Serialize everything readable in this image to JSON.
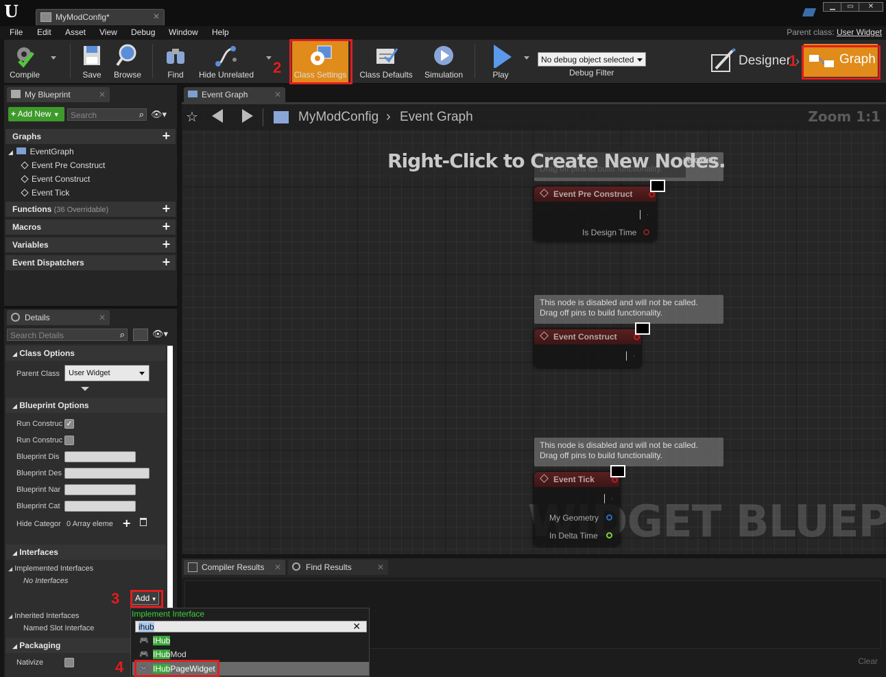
{
  "window": {
    "doc_tab": "MyModConfig*",
    "min": "▁",
    "max": "▭",
    "close": "✕"
  },
  "menu": [
    "File",
    "Edit",
    "Asset",
    "View",
    "Debug",
    "Window",
    "Help"
  ],
  "parent_class": {
    "label": "Parent class:",
    "value": "User Widget"
  },
  "toolbar": {
    "compile": "Compile",
    "save": "Save",
    "browse": "Browse",
    "find": "Find",
    "hide_unrelated": "Hide Unrelated",
    "class_settings": "Class Settings",
    "class_defaults": "Class Defaults",
    "simulation": "Simulation",
    "play": "Play",
    "debug_select": "No debug object selected",
    "debug_filter": "Debug Filter",
    "designer": "Designer",
    "graph": "Graph"
  },
  "annotations": {
    "n1": "1",
    "n2": "2",
    "n3": "3",
    "n4": "4"
  },
  "my_blueprint": {
    "tab": "My Blueprint",
    "add_new": "Add New",
    "search_placeholder": "Search",
    "graphs": "Graphs",
    "event_graph": "EventGraph",
    "events": [
      "Event Pre Construct",
      "Event Construct",
      "Event Tick"
    ],
    "functions": "Functions",
    "functions_note": "(36 Overridable)",
    "macros": "Macros",
    "variables": "Variables",
    "dispatchers": "Event Dispatchers"
  },
  "details": {
    "tab": "Details",
    "search_placeholder": "Search Details",
    "class_options": "Class Options",
    "parent_class_label": "Parent Class",
    "parent_class_value": "User Widget",
    "blueprint_options": "Blueprint Options",
    "rows": [
      "Run Construc",
      "Run Construc",
      "Blueprint Dis",
      "Blueprint Des",
      "Blueprint Nar",
      "Blueprint Cat",
      "Hide Categor"
    ],
    "array_text": "0 Array eleme",
    "interfaces": "Interfaces",
    "implemented": "Implemented Interfaces",
    "no_interfaces": "No Interfaces",
    "add": "Add",
    "inherited": "Inherited Interfaces",
    "named_slot": "Named Slot Interface",
    "packaging": "Packaging",
    "nativize": "Nativize"
  },
  "graph": {
    "tab": "Event Graph",
    "breadcrumb_root": "MyModConfig",
    "breadcrumb_leaf": "Event Graph",
    "zoom": "Zoom 1:1",
    "hint": "Right-Click to Create New Nodes.",
    "watermark": "WIDGET BLUEPRINT",
    "comment_line1": "This node is disabled and will not be called.",
    "comment_line2": "Drag off pins to build functionality.",
    "comment_partial": "be called.",
    "node1": "Event Pre Construct",
    "node1_pin": "Is Design Time",
    "node2": "Event Construct",
    "node3": "Event Tick",
    "node3_pin1": "My Geometry",
    "node3_pin2": "In Delta Time"
  },
  "bottom": {
    "compiler": "Compiler Results",
    "find": "Find Results",
    "clear": "Clear"
  },
  "popup": {
    "title": "Implement Interface",
    "query": "ihub",
    "items": [
      {
        "hl": "IHub",
        "rest": ""
      },
      {
        "hl": "IHub",
        "rest": "Mod"
      },
      {
        "hl": "IHub",
        "rest": "PageWidget"
      }
    ]
  },
  "colors": {
    "accent_orange": "#e08b1a",
    "annotation_red": "#e21d1d",
    "match_green": "#3ba53b"
  }
}
